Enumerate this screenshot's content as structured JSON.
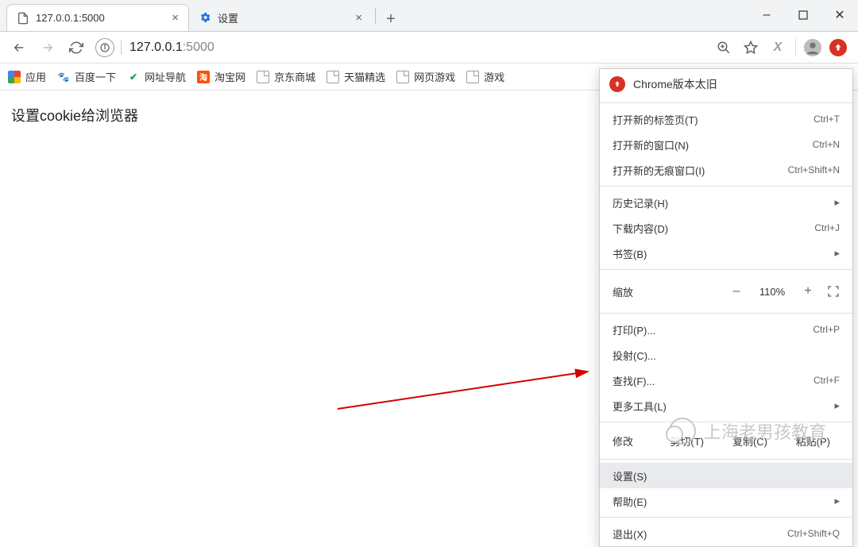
{
  "tabs": [
    {
      "title": "127.0.0.1:5000",
      "is_active": true,
      "favicon": "page"
    },
    {
      "title": "设置",
      "is_active": false,
      "favicon": "gear"
    }
  ],
  "window_controls": {
    "minimize": "–",
    "maximize": "▢",
    "close": "✕"
  },
  "toolbar": {
    "url_host": "127.0.0.1",
    "url_port": ":5000",
    "info_icon_tooltip": "查看网站信息"
  },
  "bookmarks": [
    {
      "label": "应用",
      "icon": "apps"
    },
    {
      "label": "百度一下",
      "icon": "baidu",
      "glyph": "🐾"
    },
    {
      "label": "网址导航",
      "icon": "hao",
      "glyph": "✔"
    },
    {
      "label": "淘宝网",
      "icon": "tao",
      "glyph": "淘"
    },
    {
      "label": "京东商城",
      "icon": "page"
    },
    {
      "label": "天猫精选",
      "icon": "page"
    },
    {
      "label": "网页游戏",
      "icon": "page"
    },
    {
      "label": "游戏",
      "icon": "page"
    }
  ],
  "page": {
    "heading": "设置cookie给浏览器"
  },
  "menu": {
    "header": "Chrome版本太旧",
    "items_a": [
      {
        "label": "打开新的标签页(T)",
        "shortcut": "Ctrl+T"
      },
      {
        "label": "打开新的窗口(N)",
        "shortcut": "Ctrl+N"
      },
      {
        "label": "打开新的无痕窗口(I)",
        "shortcut": "Ctrl+Shift+N"
      }
    ],
    "items_b": [
      {
        "label": "历史记录(H)",
        "submenu": true
      },
      {
        "label": "下载内容(D)",
        "shortcut": "Ctrl+J"
      },
      {
        "label": "书签(B)",
        "submenu": true
      }
    ],
    "zoom": {
      "label": "缩放",
      "minus": "–",
      "value": "110%",
      "plus": "+"
    },
    "items_c": [
      {
        "label": "打印(P)...",
        "shortcut": "Ctrl+P"
      },
      {
        "label": "投射(C)..."
      },
      {
        "label": "查找(F)...",
        "shortcut": "Ctrl+F"
      },
      {
        "label": "更多工具(L)",
        "submenu": true
      }
    ],
    "edit": {
      "label": "修改",
      "cut": "剪切(T)",
      "copy": "复制(C)",
      "paste": "粘贴(P)"
    },
    "items_d": [
      {
        "label": "设置(S)",
        "highlighted": true
      },
      {
        "label": "帮助(E)",
        "submenu": true
      }
    ],
    "items_e": [
      {
        "label": "退出(X)",
        "shortcut": "Ctrl+Shift+Q"
      }
    ]
  },
  "watermark": "上海老男孩教育"
}
